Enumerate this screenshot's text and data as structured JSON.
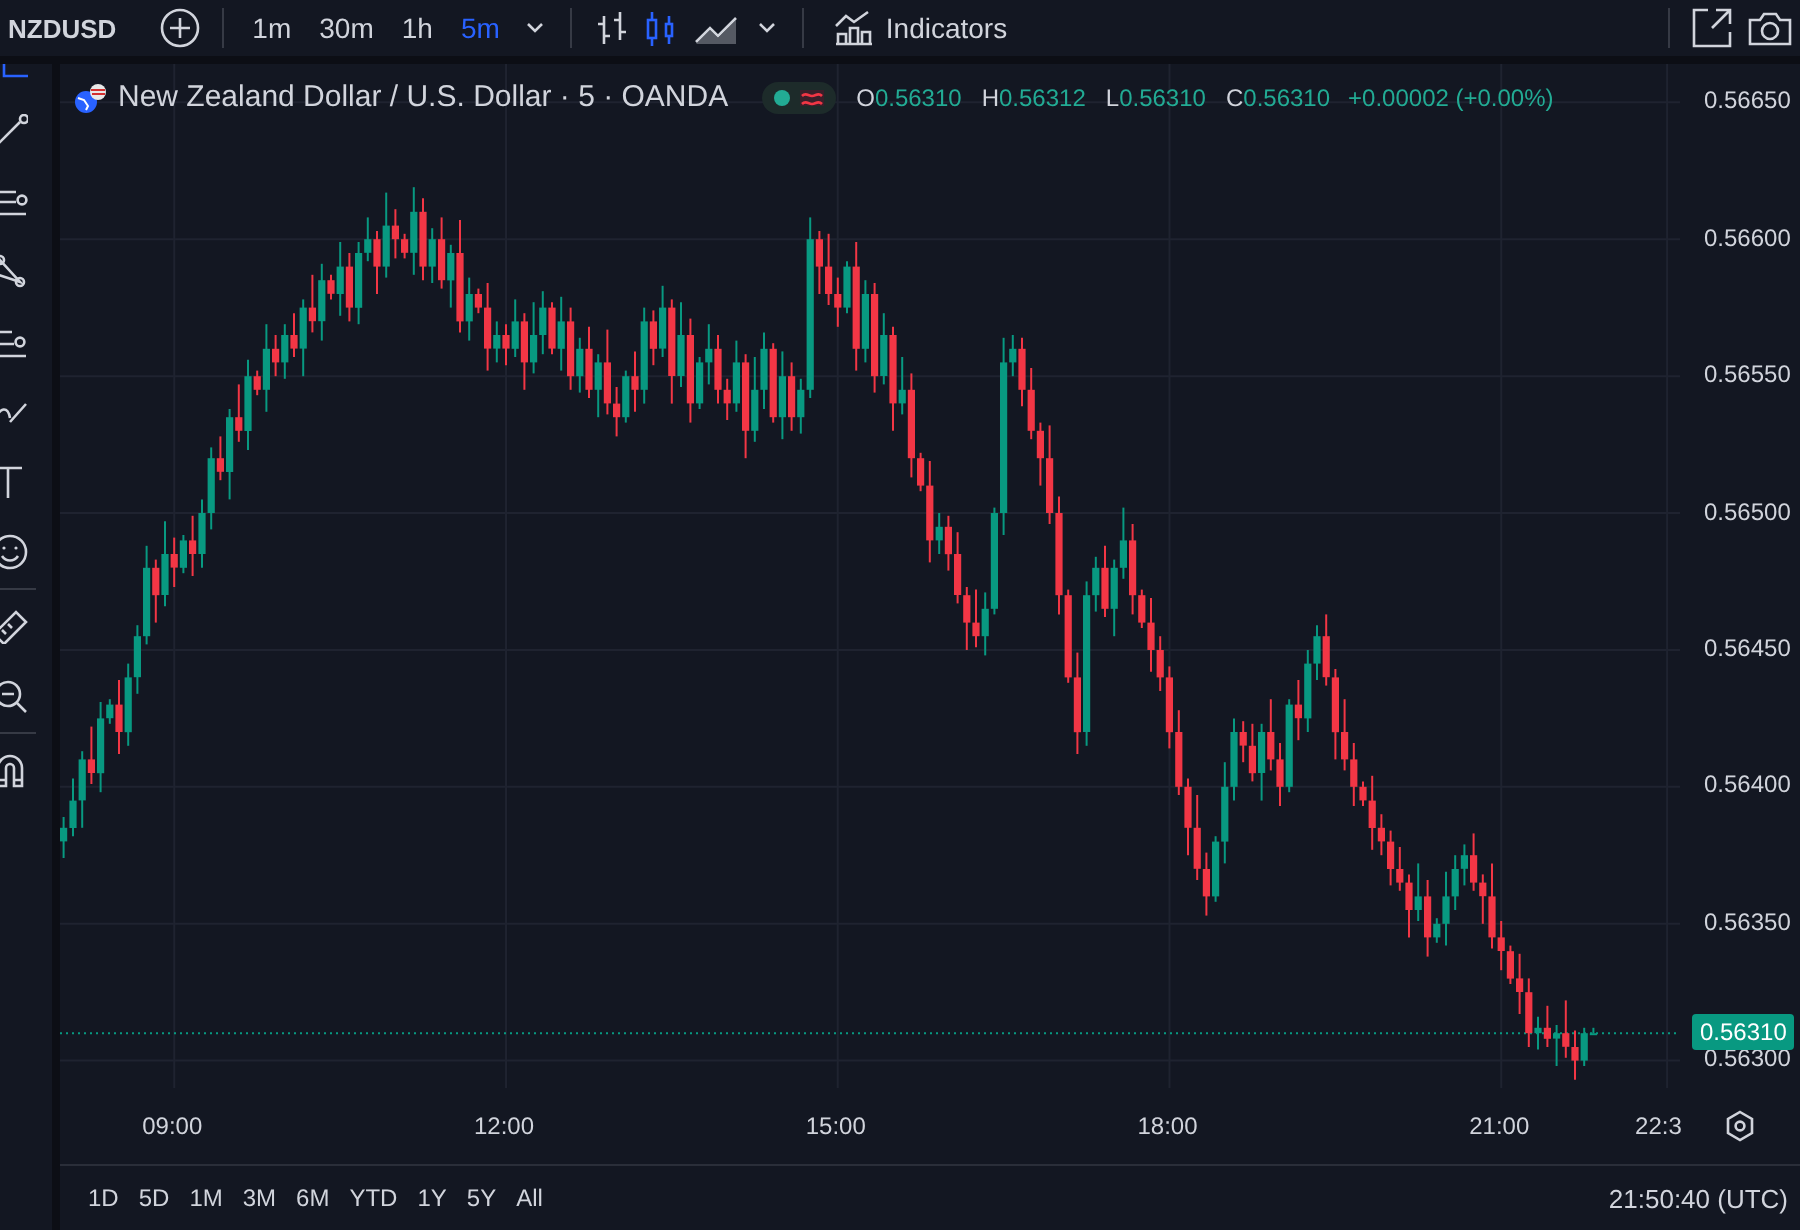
{
  "toolbar": {
    "symbol": "NZDUSD",
    "intervals": [
      {
        "label": "1m",
        "selected": false
      },
      {
        "label": "30m",
        "selected": false
      },
      {
        "label": "1h",
        "selected": false
      },
      {
        "label": "5m",
        "selected": true
      }
    ],
    "chart_styles": [
      {
        "kind": "bars",
        "selected": false
      },
      {
        "kind": "candles",
        "selected": true
      },
      {
        "kind": "area",
        "selected": false
      }
    ],
    "indicators_label": "Indicators"
  },
  "legend": {
    "title": "New Zealand Dollar / U.S. Dollar · 5 · OANDA",
    "values": [
      {
        "key": "O",
        "value": "0.56310"
      },
      {
        "key": "H",
        "value": "0.56312"
      },
      {
        "key": "L",
        "value": "0.56310"
      },
      {
        "key": "C",
        "value": "0.56310"
      }
    ],
    "change": "+0.00002 (+0.00%)"
  },
  "chart": {
    "last_price": "0.56310",
    "chart_data": {
      "type": "candlestick",
      "x": [
        480,
        485,
        490,
        495,
        500,
        505,
        510,
        515,
        520,
        525,
        530,
        535,
        540,
        545,
        550,
        555,
        560,
        565,
        570,
        575,
        580,
        585,
        590,
        595,
        600,
        605,
        610,
        615,
        620,
        625,
        630,
        635,
        640,
        645,
        650,
        655,
        660,
        665,
        670,
        675,
        680,
        685,
        690,
        695,
        700,
        705,
        710,
        715,
        720,
        725,
        730,
        735,
        740,
        745,
        750,
        755,
        760,
        765,
        770,
        775,
        780,
        785,
        790,
        795,
        800,
        805,
        810,
        815,
        820,
        825,
        830,
        835,
        840,
        845,
        850,
        855,
        860,
        865,
        870,
        875,
        880,
        885,
        890,
        895,
        900,
        905,
        910,
        915,
        920,
        925,
        930,
        935,
        940,
        945,
        950,
        955,
        960,
        965,
        970,
        975,
        980,
        985,
        990,
        995,
        1000,
        1005,
        1010,
        1015,
        1020,
        1025,
        1030,
        1035,
        1040,
        1045,
        1050,
        1055,
        1060,
        1065,
        1070,
        1075,
        1080,
        1085,
        1090,
        1095,
        1100,
        1105,
        1110,
        1115,
        1120,
        1125,
        1130,
        1135,
        1140,
        1145,
        1150,
        1155,
        1160,
        1165,
        1170,
        1175,
        1180,
        1185,
        1190,
        1195,
        1200,
        1205,
        1210,
        1215,
        1220,
        1225,
        1230,
        1235,
        1240,
        1245,
        1250,
        1255,
        1260,
        1265,
        1270,
        1275,
        1280,
        1285,
        1290,
        1295,
        1300,
        1305,
        1310
      ],
      "ohlc": [
        [
          0.5638,
          0.56389,
          0.56374,
          0.56385
        ],
        [
          0.56385,
          0.56403,
          0.56382,
          0.56395
        ],
        [
          0.56395,
          0.56413,
          0.56385,
          0.5641
        ],
        [
          0.5641,
          0.56422,
          0.56401,
          0.56405
        ],
        [
          0.56405,
          0.56431,
          0.56398,
          0.56425
        ],
        [
          0.56425,
          0.56432,
          0.56423,
          0.5643
        ],
        [
          0.5643,
          0.56439,
          0.56412,
          0.5642
        ],
        [
          0.5642,
          0.56445,
          0.56415,
          0.5644
        ],
        [
          0.5644,
          0.56459,
          0.56434,
          0.56455
        ],
        [
          0.56455,
          0.56488,
          0.56452,
          0.5648
        ],
        [
          0.5648,
          0.56483,
          0.5646,
          0.5647
        ],
        [
          0.5647,
          0.56497,
          0.56466,
          0.56485
        ],
        [
          0.56485,
          0.56491,
          0.56473,
          0.5648
        ],
        [
          0.5648,
          0.56492,
          0.56478,
          0.5649
        ],
        [
          0.5649,
          0.56499,
          0.56477,
          0.56485
        ],
        [
          0.56485,
          0.56505,
          0.5648,
          0.565
        ],
        [
          0.565,
          0.56524,
          0.56494,
          0.5652
        ],
        [
          0.5652,
          0.56528,
          0.56512,
          0.56515
        ],
        [
          0.56515,
          0.56538,
          0.56505,
          0.56535
        ],
        [
          0.56535,
          0.56547,
          0.56526,
          0.5653
        ],
        [
          0.5653,
          0.56556,
          0.56523,
          0.5655
        ],
        [
          0.5655,
          0.56552,
          0.56543,
          0.56545
        ],
        [
          0.56545,
          0.56569,
          0.56537,
          0.5656
        ],
        [
          0.5656,
          0.56565,
          0.5655,
          0.56555
        ],
        [
          0.56555,
          0.56569,
          0.56549,
          0.56565
        ],
        [
          0.56565,
          0.56573,
          0.56557,
          0.5656
        ],
        [
          0.5656,
          0.56578,
          0.5655,
          0.56575
        ],
        [
          0.56575,
          0.56587,
          0.56566,
          0.5657
        ],
        [
          0.5657,
          0.56591,
          0.56563,
          0.56585
        ],
        [
          0.56585,
          0.56587,
          0.56578,
          0.5658
        ],
        [
          0.5658,
          0.56599,
          0.56572,
          0.5659
        ],
        [
          0.5659,
          0.56595,
          0.5657,
          0.56575
        ],
        [
          0.56575,
          0.56599,
          0.56569,
          0.56595
        ],
        [
          0.56595,
          0.56608,
          0.56592,
          0.566
        ],
        [
          0.566,
          0.56603,
          0.5658,
          0.5659
        ],
        [
          0.5659,
          0.56617,
          0.56586,
          0.56605
        ],
        [
          0.56605,
          0.56611,
          0.56593,
          0.566
        ],
        [
          0.566,
          0.56602,
          0.56593,
          0.56595
        ],
        [
          0.56595,
          0.56619,
          0.56587,
          0.5661
        ],
        [
          0.5661,
          0.56615,
          0.56585,
          0.5659
        ],
        [
          0.5659,
          0.56604,
          0.56584,
          0.566
        ],
        [
          0.566,
          0.56608,
          0.56582,
          0.56585
        ],
        [
          0.56585,
          0.56598,
          0.56575,
          0.56595
        ],
        [
          0.56595,
          0.56607,
          0.56566,
          0.5657
        ],
        [
          0.5657,
          0.56586,
          0.56563,
          0.5658
        ],
        [
          0.5658,
          0.56582,
          0.56573,
          0.56575
        ],
        [
          0.56575,
          0.56584,
          0.56552,
          0.5656
        ],
        [
          0.5656,
          0.5657,
          0.56555,
          0.56565
        ],
        [
          0.56565,
          0.56569,
          0.56554,
          0.5656
        ],
        [
          0.5656,
          0.56578,
          0.56557,
          0.5657
        ],
        [
          0.5657,
          0.56573,
          0.56545,
          0.56555
        ],
        [
          0.56555,
          0.56577,
          0.56551,
          0.56565
        ],
        [
          0.56565,
          0.56581,
          0.56558,
          0.56575
        ],
        [
          0.56575,
          0.56577,
          0.56558,
          0.5656
        ],
        [
          0.5656,
          0.56579,
          0.56552,
          0.5657
        ],
        [
          0.5657,
          0.56575,
          0.56545,
          0.5655
        ],
        [
          0.5655,
          0.56564,
          0.56544,
          0.5656
        ],
        [
          0.5656,
          0.56568,
          0.56542,
          0.56545
        ],
        [
          0.56545,
          0.56558,
          0.56535,
          0.56555
        ],
        [
          0.56555,
          0.56567,
          0.56536,
          0.5654
        ],
        [
          0.5654,
          0.56546,
          0.56528,
          0.56535
        ],
        [
          0.56535,
          0.56552,
          0.56533,
          0.5655
        ],
        [
          0.5655,
          0.56559,
          0.56537,
          0.56545
        ],
        [
          0.56545,
          0.56575,
          0.5654,
          0.5657
        ],
        [
          0.5657,
          0.56574,
          0.56554,
          0.5656
        ],
        [
          0.5656,
          0.56583,
          0.56557,
          0.56575
        ],
        [
          0.56575,
          0.56578,
          0.5654,
          0.5655
        ],
        [
          0.5655,
          0.56577,
          0.56546,
          0.56565
        ],
        [
          0.56565,
          0.56571,
          0.56533,
          0.5654
        ],
        [
          0.5654,
          0.56557,
          0.56538,
          0.56555
        ],
        [
          0.56555,
          0.56569,
          0.56547,
          0.5656
        ],
        [
          0.5656,
          0.56565,
          0.5654,
          0.56545
        ],
        [
          0.56545,
          0.56549,
          0.56534,
          0.5654
        ],
        [
          0.5654,
          0.56563,
          0.56537,
          0.56555
        ],
        [
          0.56555,
          0.56558,
          0.5652,
          0.5653
        ],
        [
          0.5653,
          0.56557,
          0.56526,
          0.56545
        ],
        [
          0.56545,
          0.56566,
          0.56538,
          0.5656
        ],
        [
          0.5656,
          0.56562,
          0.56533,
          0.56535
        ],
        [
          0.56535,
          0.56559,
          0.56527,
          0.5655
        ],
        [
          0.5655,
          0.56555,
          0.5653,
          0.56535
        ],
        [
          0.56535,
          0.56549,
          0.56529,
          0.56545
        ],
        [
          0.56545,
          0.56608,
          0.56542,
          0.566
        ],
        [
          0.566,
          0.56603,
          0.5658,
          0.5659
        ],
        [
          0.5659,
          0.56602,
          0.56576,
          0.5658
        ],
        [
          0.5658,
          0.56586,
          0.56568,
          0.56575
        ],
        [
          0.56575,
          0.56592,
          0.56573,
          0.5659
        ],
        [
          0.5659,
          0.56599,
          0.56552,
          0.5656
        ],
        [
          0.5656,
          0.56585,
          0.56555,
          0.5658
        ],
        [
          0.5658,
          0.56584,
          0.56544,
          0.5655
        ],
        [
          0.5655,
          0.56573,
          0.56547,
          0.56565
        ],
        [
          0.56565,
          0.56568,
          0.5653,
          0.5654
        ],
        [
          0.5654,
          0.56557,
          0.56536,
          0.56545
        ],
        [
          0.56545,
          0.56551,
          0.56513,
          0.5652
        ],
        [
          0.5652,
          0.56522,
          0.56508,
          0.5651
        ],
        [
          0.5651,
          0.56519,
          0.56482,
          0.5649
        ],
        [
          0.5649,
          0.565,
          0.56485,
          0.56495
        ],
        [
          0.56495,
          0.56499,
          0.56479,
          0.56485
        ],
        [
          0.56485,
          0.56493,
          0.56467,
          0.5647
        ],
        [
          0.5647,
          0.56473,
          0.5645,
          0.5646
        ],
        [
          0.5646,
          0.56472,
          0.56451,
          0.56455
        ],
        [
          0.56455,
          0.56471,
          0.56448,
          0.56465
        ],
        [
          0.56465,
          0.56502,
          0.56463,
          0.565
        ],
        [
          0.565,
          0.56564,
          0.56492,
          0.56555
        ],
        [
          0.56555,
          0.56565,
          0.5655,
          0.5656
        ],
        [
          0.5656,
          0.56564,
          0.56539,
          0.56545
        ],
        [
          0.56545,
          0.56553,
          0.56527,
          0.5653
        ],
        [
          0.5653,
          0.56533,
          0.5651,
          0.5652
        ],
        [
          0.5652,
          0.56532,
          0.56496,
          0.565
        ],
        [
          0.565,
          0.56506,
          0.56463,
          0.5647
        ],
        [
          0.5647,
          0.56472,
          0.56438,
          0.5644
        ],
        [
          0.5644,
          0.56449,
          0.56412,
          0.5642
        ],
        [
          0.5642,
          0.56475,
          0.56415,
          0.5647
        ],
        [
          0.5647,
          0.56484,
          0.56464,
          0.5648
        ],
        [
          0.5648,
          0.56488,
          0.56462,
          0.56465
        ],
        [
          0.56465,
          0.56483,
          0.56455,
          0.5648
        ],
        [
          0.5648,
          0.56502,
          0.56476,
          0.5649
        ],
        [
          0.5649,
          0.56496,
          0.56463,
          0.5647
        ],
        [
          0.5647,
          0.56472,
          0.56458,
          0.5646
        ],
        [
          0.5646,
          0.56469,
          0.56442,
          0.5645
        ],
        [
          0.5645,
          0.56455,
          0.56435,
          0.5644
        ],
        [
          0.5644,
          0.56444,
          0.56414,
          0.5642
        ],
        [
          0.5642,
          0.56428,
          0.56397,
          0.564
        ],
        [
          0.564,
          0.56403,
          0.56375,
          0.56385
        ],
        [
          0.56385,
          0.56397,
          0.56366,
          0.5637
        ],
        [
          0.5637,
          0.56376,
          0.56353,
          0.5636
        ],
        [
          0.5636,
          0.56382,
          0.56358,
          0.5638
        ],
        [
          0.5638,
          0.56409,
          0.56372,
          0.564
        ],
        [
          0.564,
          0.56425,
          0.56395,
          0.5642
        ],
        [
          0.5642,
          0.56424,
          0.56409,
          0.56415
        ],
        [
          0.56415,
          0.56423,
          0.56402,
          0.56405
        ],
        [
          0.56405,
          0.56423,
          0.56395,
          0.5642
        ],
        [
          0.5642,
          0.56432,
          0.56406,
          0.5641
        ],
        [
          0.5641,
          0.56416,
          0.56393,
          0.564
        ],
        [
          0.564,
          0.56432,
          0.56398,
          0.5643
        ],
        [
          0.5643,
          0.56439,
          0.56417,
          0.56425
        ],
        [
          0.56425,
          0.5645,
          0.5642,
          0.56445
        ],
        [
          0.56445,
          0.56459,
          0.56439,
          0.56455
        ],
        [
          0.56455,
          0.56463,
          0.56437,
          0.5644
        ],
        [
          0.5644,
          0.56443,
          0.5641,
          0.5642
        ],
        [
          0.5642,
          0.56432,
          0.56406,
          0.5641
        ],
        [
          0.5641,
          0.56416,
          0.56393,
          0.564
        ],
        [
          0.564,
          0.56402,
          0.56393,
          0.56395
        ],
        [
          0.56395,
          0.56404,
          0.56377,
          0.56385
        ],
        [
          0.56385,
          0.5639,
          0.56375,
          0.5638
        ],
        [
          0.5638,
          0.56384,
          0.56364,
          0.5637
        ],
        [
          0.5637,
          0.56378,
          0.56362,
          0.56365
        ],
        [
          0.56365,
          0.56368,
          0.56345,
          0.56355
        ],
        [
          0.56355,
          0.56372,
          0.56351,
          0.5636
        ],
        [
          0.5636,
          0.56366,
          0.56338,
          0.56345
        ],
        [
          0.56345,
          0.56352,
          0.56343,
          0.5635
        ],
        [
          0.5635,
          0.56369,
          0.56342,
          0.5636
        ],
        [
          0.5636,
          0.56375,
          0.56355,
          0.5637
        ],
        [
          0.5637,
          0.56379,
          0.56364,
          0.56375
        ],
        [
          0.56375,
          0.56383,
          0.56362,
          0.56365
        ],
        [
          0.56365,
          0.56368,
          0.5635,
          0.5636
        ],
        [
          0.5636,
          0.56372,
          0.56341,
          0.56345
        ],
        [
          0.56345,
          0.56351,
          0.56333,
          0.5634
        ],
        [
          0.5634,
          0.56342,
          0.56328,
          0.5633
        ],
        [
          0.5633,
          0.56339,
          0.56317,
          0.56325
        ],
        [
          0.56325,
          0.5633,
          0.56305,
          0.5631
        ],
        [
          0.5631,
          0.56316,
          0.56304,
          0.56312
        ],
        [
          0.56312,
          0.5632,
          0.56305,
          0.56308
        ],
        [
          0.56308,
          0.56313,
          0.56298,
          0.5631
        ],
        [
          0.5631,
          0.56322,
          0.56301,
          0.56305
        ],
        [
          0.56305,
          0.56311,
          0.56293,
          0.563
        ],
        [
          0.563,
          0.56312,
          0.56298,
          0.5631
        ],
        [
          0.5631,
          0.56312,
          0.5631,
          0.5631
        ]
      ],
      "xlim": [
        478,
        1357
      ],
      "ylim": [
        0.5629,
        0.56664
      ],
      "grid": true,
      "ref_lines": [
        {
          "axis": "y",
          "value": 0.5631,
          "color": "#089981"
        }
      ],
      "xticks": [
        {
          "value": 540,
          "label": "09:00"
        },
        {
          "value": 720,
          "label": "12:00"
        },
        {
          "value": 900,
          "label": "15:00"
        },
        {
          "value": 1080,
          "label": "18:00"
        },
        {
          "value": 1260,
          "label": "21:00"
        },
        {
          "value": 1350,
          "label": "22:3"
        }
      ],
      "yticks": [
        {
          "value": 0.5665,
          "label": "0.56650"
        },
        {
          "value": 0.566,
          "label": "0.56600"
        },
        {
          "value": 0.5655,
          "label": "0.56550"
        },
        {
          "value": 0.565,
          "label": "0.56500"
        },
        {
          "value": 0.5645,
          "label": "0.56450"
        },
        {
          "value": 0.564,
          "label": "0.56400"
        },
        {
          "value": 0.5635,
          "label": "0.56350"
        },
        {
          "value": 0.563,
          "label": "0.56300"
        }
      ]
    }
  },
  "bottom_bar": {
    "ranges": [
      "1D",
      "5D",
      "1M",
      "3M",
      "6M",
      "YTD",
      "1Y",
      "5Y",
      "All"
    ],
    "clock": "21:50:40 (UTC)"
  }
}
